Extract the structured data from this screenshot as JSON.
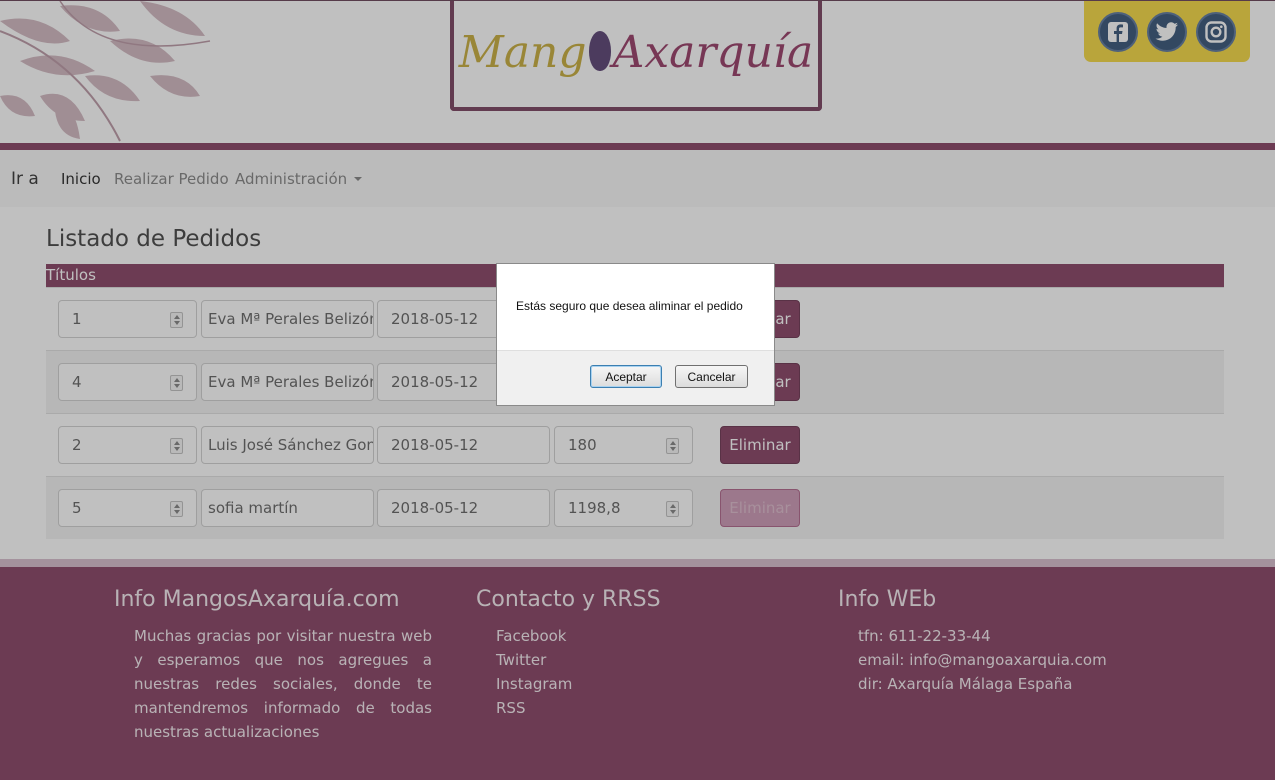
{
  "header": {
    "logo_part1": "Mang",
    "logo_part2": "Axarquía",
    "social": [
      "facebook-icon",
      "twitter-icon",
      "instagram-icon"
    ]
  },
  "nav": {
    "brand": "Ir a",
    "items": [
      {
        "label": "Inicio"
      },
      {
        "label": "Realizar Pedido"
      },
      {
        "label": "Administración"
      }
    ]
  },
  "main": {
    "title": "Listado de Pedidos",
    "table_header": "Títulos",
    "rows": [
      {
        "id": "1",
        "name": "Eva Mª Perales Belizón",
        "date": "2018-05-12",
        "amount": "",
        "action": "Eliminar"
      },
      {
        "id": "4",
        "name": "Eva Mª Perales Belizón",
        "date": "2018-05-12",
        "amount": "",
        "action": "Eliminar"
      },
      {
        "id": "2",
        "name": "Luis José Sánchez Gonz",
        "date": "2018-05-12",
        "amount": "180",
        "action": "Eliminar"
      },
      {
        "id": "5",
        "name": "sofia martín",
        "date": "2018-05-12",
        "amount": "1198,8",
        "action": "Eliminar"
      }
    ]
  },
  "footer": {
    "col1": {
      "title": "Info MangosAxarquía.com",
      "text": "Muchas gracias por visitar nuestra web y esperamos que nos agregues a nuestras redes sociales, donde te mantendremos informado de todas nuestras actualizaciones"
    },
    "col2": {
      "title": "Contacto y RRSS",
      "links": [
        "Facebook",
        "Twitter",
        "Instagram",
        "RSS"
      ]
    },
    "col3": {
      "title": "Info WEb",
      "lines": [
        "tfn: 611-22-33-44",
        "email: info@mangoaxarquia.com",
        "dir: Axarquía Málaga España"
      ]
    }
  },
  "dialog": {
    "message": "Estás seguro que desea aliminar el pedido",
    "ok": "Aceptar",
    "cancel": "Cancelar"
  },
  "colors": {
    "brand": "#7c2f55",
    "social_bg": "#f5d530",
    "logo_gold": "#c3a52a"
  }
}
